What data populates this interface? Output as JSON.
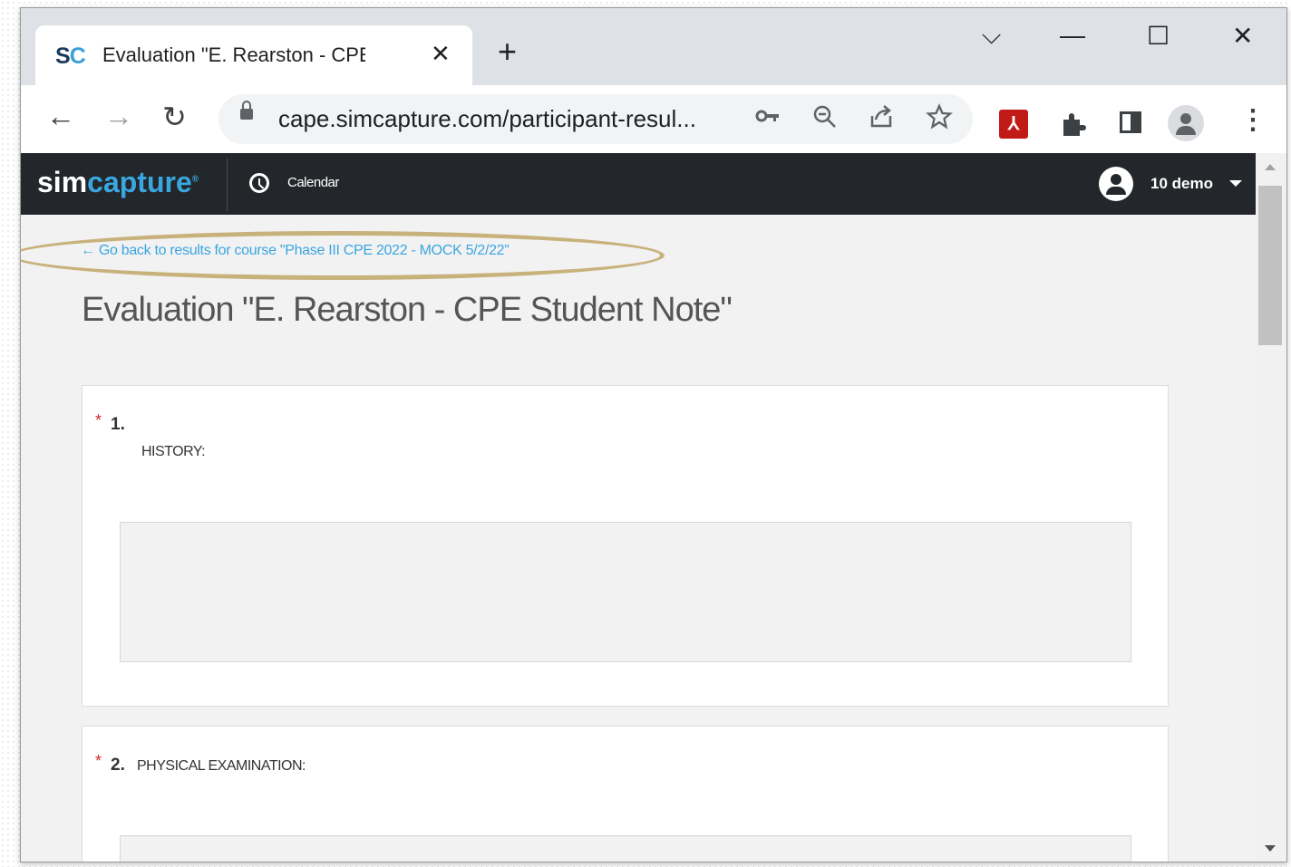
{
  "browser": {
    "tab": {
      "favicon": "SC",
      "title": "Evaluation \"E. Rearston - CPE Stu",
      "close": "✕"
    },
    "new_tab": "+",
    "window_controls": {
      "tab_search": "⌵",
      "minimize": "—",
      "maximize": "☐",
      "close": "✕"
    },
    "nav": {
      "back": "←",
      "forward": "→",
      "reload": "↻"
    },
    "address": "cape.simcapture.com/participant-resul...",
    "omnibox_icons": [
      "key-icon",
      "zoom-icon",
      "share-icon",
      "star-icon"
    ],
    "toolbar_icons": [
      "pdf-icon",
      "extensions-icon",
      "side-panel-icon",
      "profile-icon",
      "menu-icon"
    ]
  },
  "app": {
    "logo_part1": "sim",
    "logo_part2": "capture",
    "logo_mark": "®",
    "nav_calendar": "Calendar",
    "user": "10 demo",
    "back_link": "← Go back to results for course \"Phase III CPE 2022 - MOCK 5/2/22\"",
    "page_title": "Evaluation \"E. Rearston - CPE Student Note\"",
    "questions": [
      {
        "required": "*",
        "number": "1.",
        "label": "HISTORY:"
      },
      {
        "required": "*",
        "number": "2.",
        "label": "PHYSICAL EXAMINATION:"
      }
    ]
  },
  "colors": {
    "brand_blue": "#3aa6e0",
    "nav_dark": "#23272b",
    "highlight_gold": "#c8b27c",
    "required_red": "#d9262c"
  }
}
